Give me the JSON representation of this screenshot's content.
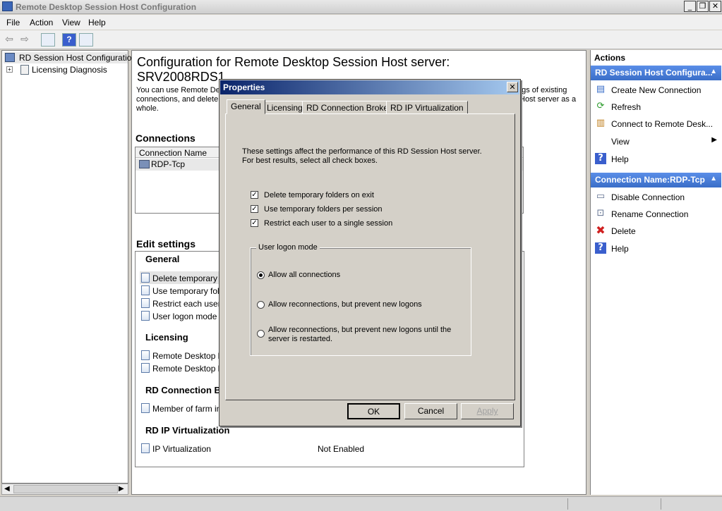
{
  "window": {
    "title": "Remote Desktop Session Host Configuration"
  },
  "menu": [
    "File",
    "Action",
    "View",
    "Help"
  ],
  "tree": {
    "root": "RD Session Host Configuration:",
    "child": "Licensing Diagnosis"
  },
  "main": {
    "title": "Configuration for Remote Desktop Session Host server:",
    "server": "SRV2008RDS1",
    "description": [
      "You can use Remote De",
      "ngs of existing",
      "connections, and delete",
      "Host server as a",
      "whole."
    ],
    "connections": {
      "heading": "Connections",
      "column": "Connection Name",
      "rows": [
        "RDP-Tcp"
      ]
    },
    "edit_settings": {
      "heading": "Edit settings",
      "general": {
        "label": "General",
        "items": [
          "Delete temporary folde",
          "Use temporary folder",
          "Restrict each user to",
          "User logon mode"
        ]
      },
      "licensing": {
        "label": "Licensing",
        "items": [
          "Remote Desktop lice",
          "Remote Desktop lice"
        ]
      },
      "broker": {
        "label": "RD Connection Bro",
        "items": [
          "Member of farm in R"
        ]
      },
      "ipvirt": {
        "label": "RD IP Virtualization",
        "items": [
          {
            "name": "IP Virtualization",
            "value": "Not Enabled"
          }
        ]
      }
    }
  },
  "actions": {
    "header": "Actions",
    "section1": {
      "title": "RD Session Host Configura...",
      "items": [
        "Create New Connection",
        "Refresh",
        "Connect to Remote Desk...",
        "View",
        "Help"
      ]
    },
    "section2": {
      "title": "Connection Name:RDP-Tcp",
      "items": [
        "Disable Connection",
        "Rename Connection",
        "Delete",
        "Help"
      ]
    }
  },
  "dialog": {
    "title": "Properties",
    "tabs": [
      "General",
      "Licensing",
      "RD Connection Broker",
      "RD IP Virtualization"
    ],
    "intro_line1": "These settings affect the performance of this RD Session Host server.",
    "intro_line2": "For best results, select all check boxes.",
    "checkboxes": [
      {
        "label": "Delete temporary folders on exit",
        "checked": true
      },
      {
        "label": "Use temporary folders per session",
        "checked": true
      },
      {
        "label": "Restrict each user to a single session",
        "checked": true
      }
    ],
    "logon_group": "User logon mode",
    "radios": [
      {
        "label": "Allow all connections",
        "selected": true
      },
      {
        "label": "Allow reconnections, but prevent new logons",
        "selected": false
      },
      {
        "label_line1": "Allow reconnections, but prevent new logons until the",
        "label_line2": "server is restarted.",
        "selected": false
      }
    ],
    "buttons": {
      "ok": "OK",
      "cancel": "Cancel",
      "apply": "Apply"
    }
  }
}
